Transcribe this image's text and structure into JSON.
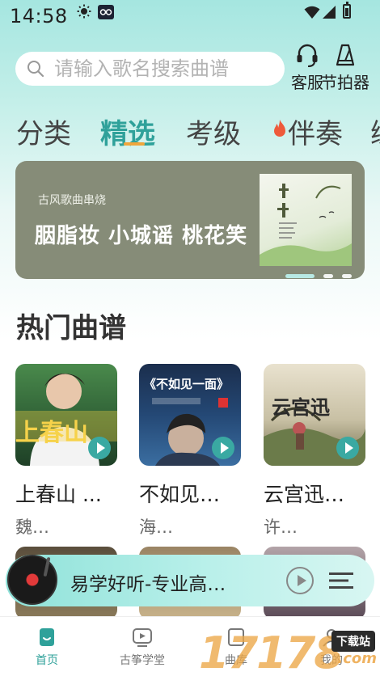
{
  "status_bar": {
    "time": "14:58"
  },
  "search": {
    "placeholder": "请输入歌名搜索曲谱"
  },
  "header_buttons": {
    "service_label": "客服",
    "metronome_label": "节拍器"
  },
  "tabs": [
    {
      "label": "分类",
      "active": false
    },
    {
      "label": "精选",
      "active": true
    },
    {
      "label": "考级",
      "active": false
    },
    {
      "label": "伴奏",
      "active": false,
      "hot": true
    },
    {
      "label": "练",
      "active": false
    }
  ],
  "banner": {
    "subtitle": "古风歌曲串烧",
    "title": "胭脂妆 小城谣 桃花笑",
    "slide_index": 1,
    "slide_count": 3
  },
  "section": {
    "title": "热门曲谱"
  },
  "songs": [
    {
      "name": "上春山 ...",
      "author": "魏…",
      "thumb_text": "上春山"
    },
    {
      "name": "不如见…",
      "author": "海…",
      "thumb_text": "《不如见一面》"
    },
    {
      "name": "云宫迅…",
      "author": "许…",
      "thumb_text": "云宫迅"
    }
  ],
  "player": {
    "title": "易学好听-专业高…"
  },
  "bottom_nav": [
    {
      "label": "首页",
      "active": true
    },
    {
      "label": "古筝学堂",
      "active": false
    },
    {
      "label": "曲库",
      "active": false
    },
    {
      "label": "我的",
      "active": false
    }
  ],
  "watermark": {
    "digits": "17178",
    "badge": "下载站",
    "domain": ".com"
  },
  "colors": {
    "accent": "#2fa19a",
    "tab_underline": "#f0a63c",
    "banner_bg": "#868c78"
  }
}
